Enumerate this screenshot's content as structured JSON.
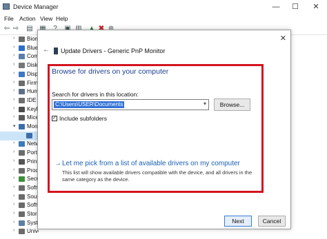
{
  "window": {
    "title": "Device Manager",
    "minimize": "—",
    "maximize": "☐",
    "close": "✕"
  },
  "menu": [
    "File",
    "Action",
    "View",
    "Help"
  ],
  "tree": [
    {
      "label": "Biometric",
      "color": "#6b6b6b",
      "expanded": false
    },
    {
      "label": "Bluetooth",
      "color": "#2a6fc9",
      "expanded": false
    },
    {
      "label": "Computer",
      "color": "#5a7fa8",
      "expanded": false
    },
    {
      "label": "Disk drives",
      "color": "#777777",
      "expanded": false
    },
    {
      "label": "Display",
      "color": "#3c78c4",
      "expanded": false
    },
    {
      "label": "Firmware",
      "color": "#6c6c6c",
      "expanded": false
    },
    {
      "label": "Human",
      "color": "#5c6f86",
      "expanded": false
    },
    {
      "label": "IDE",
      "color": "#6e6e6e",
      "expanded": false
    },
    {
      "label": "Keyboards",
      "color": "#4b4b4b",
      "expanded": false
    },
    {
      "label": "Mice",
      "color": "#5a5a5a",
      "expanded": false
    },
    {
      "label": "Monitors",
      "color": "#3a6ea8",
      "expanded": true
    },
    {
      "label": "",
      "color": "#3a6ea8",
      "expanded": false,
      "child": true
    },
    {
      "label": "Network",
      "color": "#3c7ab8",
      "expanded": false
    },
    {
      "label": "Ports",
      "color": "#6b6b6b",
      "expanded": false
    },
    {
      "label": "Print",
      "color": "#555555",
      "expanded": false
    },
    {
      "label": "Processors",
      "color": "#6a6a6a",
      "expanded": false
    },
    {
      "label": "Security",
      "color": "#3d8f3d",
      "expanded": false
    },
    {
      "label": "Software",
      "color": "#6b6b6b",
      "expanded": false
    },
    {
      "label": "Sound",
      "color": "#6b6b6b",
      "expanded": false
    },
    {
      "label": "Software",
      "color": "#6b6b6b",
      "expanded": false
    },
    {
      "label": "Storage",
      "color": "#6b6b6b",
      "expanded": false
    },
    {
      "label": "System",
      "color": "#5d7fa3",
      "expanded": false
    },
    {
      "label": "Universal",
      "color": "#6b6b6b",
      "expanded": false
    }
  ],
  "dialog": {
    "close": "✕",
    "back": "←",
    "title": "Update Drivers - Generic PnP Monitor",
    "heading": "Browse for drivers on your computer",
    "search_label": "Search for drivers in this location:",
    "path_value": "C:\\Users\\USER\\Documents",
    "browse_label": "Browse...",
    "include_subfolders": "Include subfolders",
    "include_checked": true,
    "pick_arrow": "→",
    "pick_link": "Let me pick from a list of available drivers on my computer",
    "pick_desc": "This list will show available drivers compatible with the device, and all drivers in the same category as the device.",
    "next_label": "Next",
    "cancel_label": "Cancel"
  },
  "colors": {
    "highlight": "#d3121f",
    "heading": "#1a3d8f",
    "link": "#1a5fb4"
  }
}
